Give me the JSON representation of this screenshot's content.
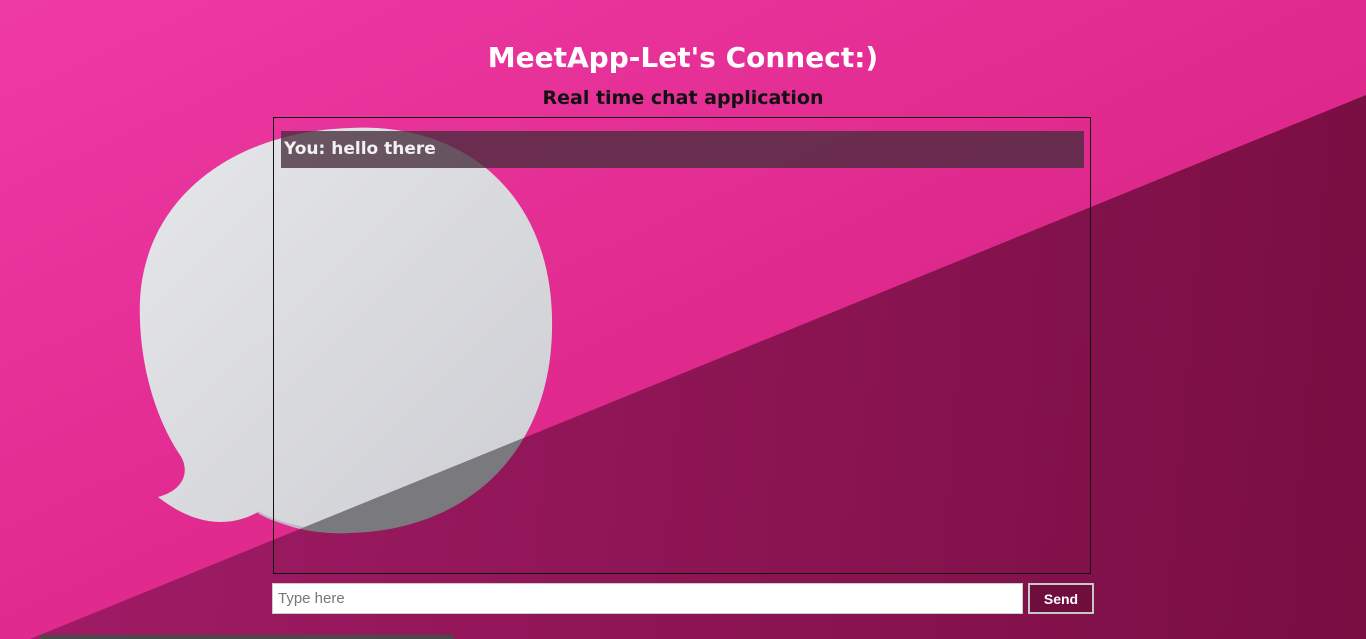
{
  "header": {
    "title": "MeetApp-Let's Connect:)",
    "subtitle": "Real time chat application"
  },
  "chat": {
    "messages": [
      {
        "text": "You: hello there"
      }
    ]
  },
  "composer": {
    "placeholder": "Type here",
    "value": "",
    "send_label": "Send"
  },
  "colors": {
    "background_pink": "#e0288f",
    "background_dark": "#8a1552",
    "send_button": "#6f0d3d",
    "message_bg": "#462d3c"
  },
  "icons": {
    "background_illustration": "speech-bubble-icon"
  }
}
